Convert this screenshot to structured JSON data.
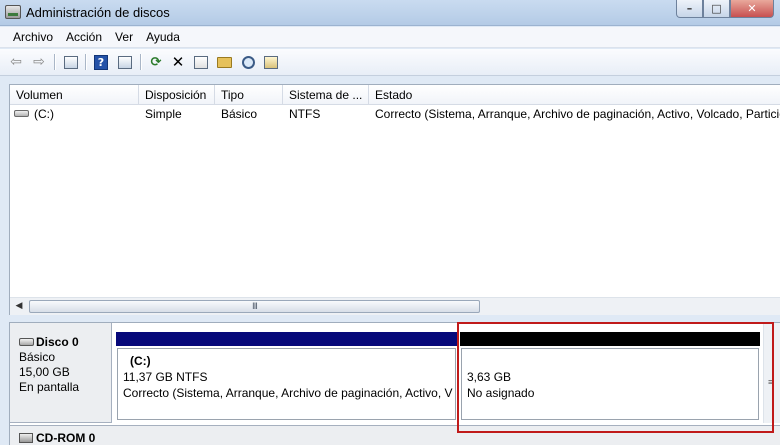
{
  "window": {
    "title": "Administración de discos",
    "controls": {
      "minimize": "–",
      "maximize": "□",
      "close": "✕"
    }
  },
  "menubar": {
    "items": [
      "Archivo",
      "Acción",
      "Ver",
      "Ayuda"
    ]
  },
  "toolbar": {
    "buttons": [
      "back-icon",
      "forward-icon",
      "show-hide-tree-icon",
      "help-icon",
      "show-hide-action-pane-icon",
      "refresh-icon",
      "delete-icon",
      "properties-icon",
      "open-icon",
      "explore-icon",
      "view-icon"
    ]
  },
  "volume_list": {
    "columns": [
      "Volumen",
      "Disposición",
      "Tipo",
      "Sistema de ...",
      "Estado"
    ],
    "rows": [
      {
        "volume": "(C:)",
        "layout": "Simple",
        "type": "Básico",
        "filesystem": "NTFS",
        "status": "Correcto (Sistema, Arranque, Archivo de paginación, Activo, Volcado, Partición"
      }
    ],
    "scroll_grip": "III"
  },
  "disk_map": {
    "disk0": {
      "name": "Disco 0",
      "type": "Básico",
      "size": "15,00 GB",
      "state": "En pantalla",
      "partitions": [
        {
          "name": "(C:)",
          "size_fs": "11,37 GB NTFS",
          "status": "Correcto (Sistema, Arranque, Archivo de paginación, Activo, V",
          "bar_color": "#06087a"
        },
        {
          "size": "3,63 GB",
          "status": "No asignado",
          "bar_color": "#000000"
        }
      ]
    },
    "cdrom": {
      "name": "CD-ROM 0"
    },
    "highlight_color": "#c01a1a"
  }
}
